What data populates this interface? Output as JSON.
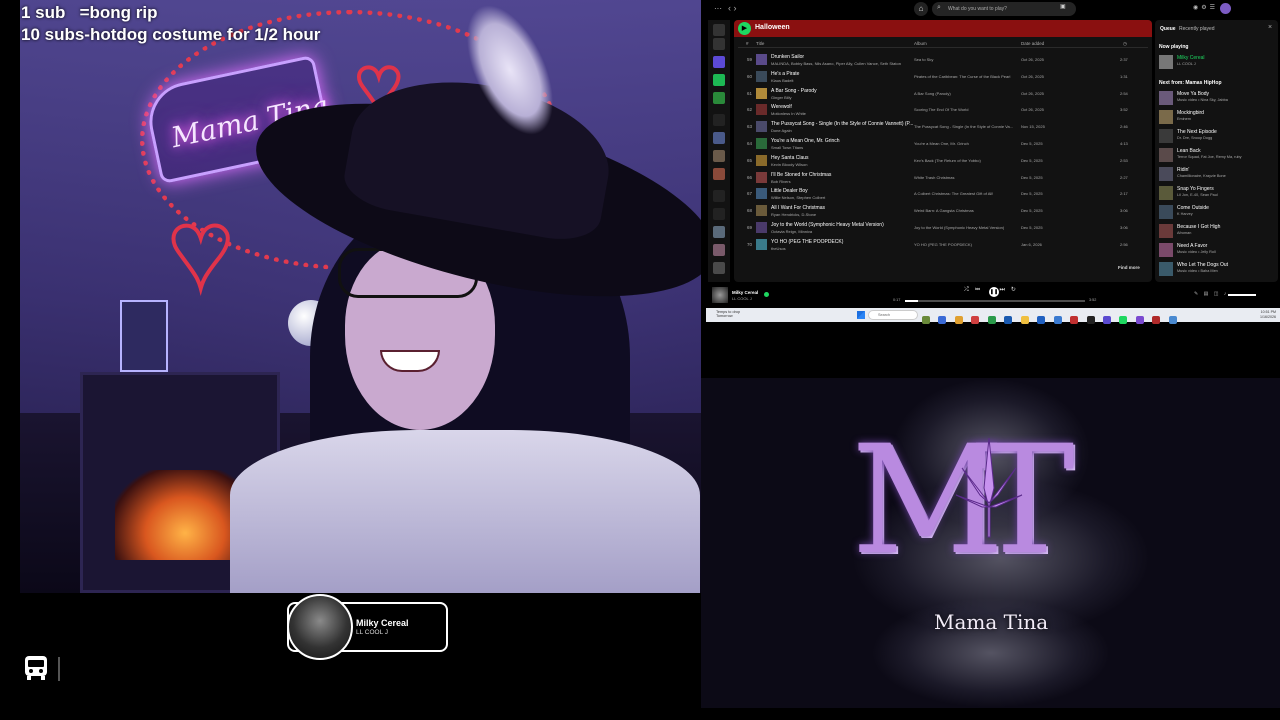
{
  "overlay": {
    "sub_goal_1": "1 sub   =bong rip",
    "sub_goal_2": "10 subs-hotdog costume for 1/2 hour"
  },
  "webcam": {
    "neon_sign_text": "Mama Tina"
  },
  "now_playing_card": {
    "title": "Milky Cereal",
    "artist": "LL COOL J"
  },
  "logo": {
    "letters": "MT",
    "name": "Mama Tina"
  },
  "spotify": {
    "search_placeholder": "What do you want to play?",
    "playlist_title": "Halloween",
    "columns": {
      "num": "#",
      "title": "Title",
      "album": "Album",
      "date": "Date added",
      "duration": "◷"
    },
    "rows": [
      {
        "num": "59",
        "title": "Drunken Sailor",
        "artist": "MALINDA, Bobby Bass, Nils Asano, Piper Ally, Cullen Vance, Seth Staton",
        "album": "Sea to Sky",
        "date": "Oct 26, 2025",
        "duration": "2:37",
        "color": "#5a4a8a"
      },
      {
        "num": "60",
        "title": "He's a Pirate",
        "artist": "Klaus Badelt",
        "album": "Pirates of the Caribbean: The Curse of the Black Pearl",
        "date": "Oct 26, 2025",
        "duration": "1:31",
        "color": "#3a4a5a"
      },
      {
        "num": "61",
        "title": "A Bar Song - Parody",
        "artist": "Ginger Billy",
        "album": "A Bar Song (Parody)",
        "date": "Oct 26, 2025",
        "duration": "2:54",
        "color": "#b08a3a"
      },
      {
        "num": "62",
        "title": "Werewolf",
        "artist": "Motionless In White",
        "album": "Scoring The End Of The World",
        "date": "Oct 26, 2025",
        "duration": "3:52",
        "color": "#6a2a2a"
      },
      {
        "num": "63",
        "title": "The Pussycat Song - Single (In the Style of Connie Vannett) (P...",
        "artist": "Done Again",
        "album": "The Pussycat Song - Single (In the Style of Connie Va...",
        "date": "Nov 15, 2025",
        "duration": "2:46",
        "color": "#4a4a6a"
      },
      {
        "num": "64",
        "title": "You're a Mean One, Mr. Grinch",
        "artist": "Small Town Titans",
        "album": "You're a Mean One, Mr. Grinch",
        "date": "Dec 5, 2025",
        "duration": "4:13",
        "color": "#2a6a3a"
      },
      {
        "num": "65",
        "title": "Hey Santa Claus",
        "artist": "Kevin Bloody Wilson",
        "album": "Kev's Back (The Return of the Yobbo)",
        "date": "Dec 5, 2025",
        "duration": "2:53",
        "color": "#8a6a2a"
      },
      {
        "num": "66",
        "title": "I'll Be Stoned for Christmas",
        "artist": "Bob Rivers",
        "album": "White Trash Christmas",
        "date": "Dec 5, 2025",
        "duration": "2:27",
        "color": "#7a3a3a"
      },
      {
        "num": "67",
        "title": "Little Dealer Boy",
        "artist": "Willie Nelson, Stephen Colbert",
        "album": "A Colbert Christmas: The Greatest Gift of All!",
        "date": "Dec 5, 2025",
        "duration": "2:17",
        "color": "#3a5a7a"
      },
      {
        "num": "68",
        "title": "All I Want For Christmas",
        "artist": "Ryan Hendricks, D-Stone",
        "album": "Weird Barn: A Gangsta Christmas",
        "date": "Dec 5, 2025",
        "duration": "3:06",
        "color": "#6a5a3a"
      },
      {
        "num": "69",
        "title": "Joy to the World (Symphonic Heavy Metal Version)",
        "artist": "Octavia Reign, Minniva",
        "album": "Joy to the World (Symphonic Heavy Metal Version)",
        "date": "Dec 5, 2025",
        "duration": "3:06",
        "color": "#4a3a6a"
      },
      {
        "num": "70",
        "title": "YO HO (PEG THE POOPDECK)",
        "artist": "theUsos",
        "album": "YO HO (PEG THE POOPDECK)",
        "date": "Jan 6, 2026",
        "duration": "2:56",
        "color": "#3a7a8a"
      }
    ],
    "find_more": "Find more",
    "queue": {
      "tab_queue": "Queue",
      "tab_recent": "Recently played",
      "now_playing_label": "Now playing",
      "now_playing": {
        "title": "Milky Cereal",
        "sub": "LL COOL J"
      },
      "next_label": "Next from: Mamas HipHop",
      "items": [
        {
          "title": "Move Ya Body",
          "sub": "Music video • Nina Sky, Jabba"
        },
        {
          "title": "Mockingbird",
          "sub": "Eminem"
        },
        {
          "title": "The Next Episode",
          "sub": "Dr. Dre, Snoop Dogg"
        },
        {
          "title": "Lean Back",
          "sub": "Terror Squad, Fat Joe, Remy Ma, ruby"
        },
        {
          "title": "Ridin'",
          "sub": "Chamillionaire, Krayzie Bone"
        },
        {
          "title": "Snap Yo Fingers",
          "sub": "Lil Jon, E-40, Sean Paul"
        },
        {
          "title": "Come Outside",
          "sub": "K Harvey"
        },
        {
          "title": "Because I Got High",
          "sub": "Afroman"
        },
        {
          "title": "Need A Favor",
          "sub": "Music video • Jelly Roll"
        },
        {
          "title": "Who Let The Dogs Out",
          "sub": "Music video • Baha Men"
        }
      ]
    },
    "player": {
      "title": "Milky Cereal",
      "artist": "LL COOL J",
      "time_elapsed": "0:17",
      "time_total": "3:52",
      "progress": 0.07
    }
  },
  "taskbar": {
    "weather_1": "Temps to drop",
    "weather_2": "Tomorrow",
    "search": "Search",
    "time": "10:51 PM",
    "date": "1/16/2026"
  }
}
